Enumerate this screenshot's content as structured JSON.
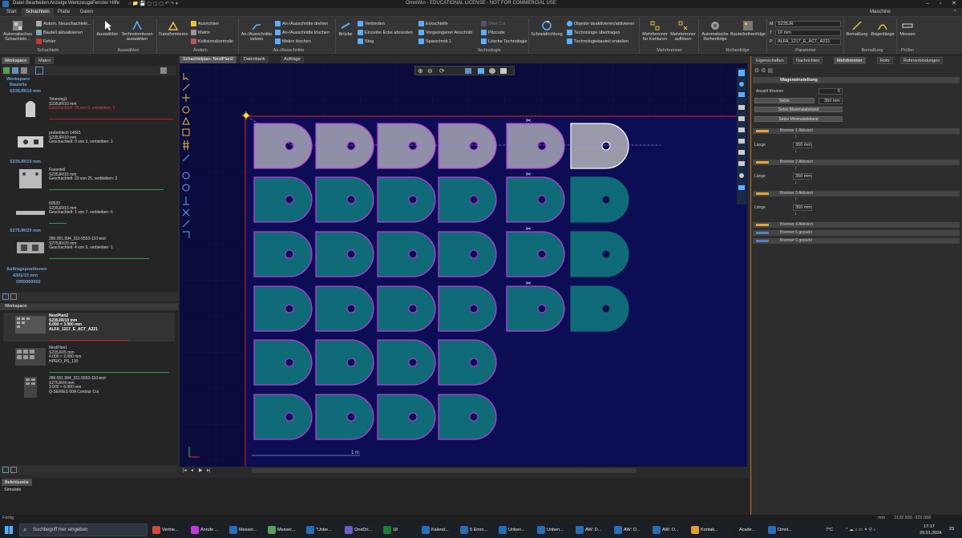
{
  "window": {
    "title": "OmniWin - EDUCATIONAL LICENSE - NOT FOR COMMERCIAL USE"
  },
  "menu": [
    "Datei",
    "Bearbeiten",
    "Anzeige",
    "Werkzeuge",
    "Fenster",
    "Hilfe"
  ],
  "tabs": [
    "Start",
    "Schachteln",
    "Platte",
    "Daten"
  ],
  "active_tab": "Schachteln",
  "machine_label": "Maschine",
  "ribbon": {
    "auto_schachteln": "Automatisches Schachteln...",
    "autom_neuschachteln": "Autom. Neuschachteln...",
    "bauteil_aktualisieren": "Bauteil aktualisieren",
    "fehler": "Fehler",
    "group_schachteln": "Schachteln",
    "auswaehlen": "Auswählen",
    "technokonturen": "Technokonturen auswählen",
    "group_auswaehlen": "Auswählen",
    "transformieren": "Transformieren",
    "ausrichten": "Ausrichten",
    "matrix": "Matrix",
    "kollisionskontrolle": "Kollisionskontrolle",
    "group_aendern": "Ändern",
    "an_ausschnitte_setzen": "An-/Ausschnitte setzen",
    "an_ausschnitte_drehen": "An-/Ausschnitte drehen",
    "an_ausschnitte_loeschen": "An-/Ausschnitte löschen",
    "makro_loeschen": "Makro löschen",
    "group_anausschnitte": "An-/Ausschnitte",
    "bruecke": "Brücke",
    "verbinden": "Verbinden",
    "einzelne_ecke": "Einzelne Ecke abrunden",
    "steg": "Steg",
    "eckschleife": "Eckschleife",
    "vorgezogener_anschnitt": "Vorgezogener Anschnitt",
    "sparschnitt": "Sparschnitt 1",
    "start_cut": "Start Cut",
    "pilzcode": "Pilzcode",
    "loesche_technologie": "Lösche Technologie",
    "group_technologie": "Technologie",
    "schneidrichtung": "Schneidrichtung",
    "objekte_deaktivieren": "Objekte deaktivieren/aktivieren",
    "technologie_uebertragen": "Technologie übertragen",
    "technologiebauteil": "Technologiebauteil erstellen",
    "mehrbrenner_konturen": "Mehrbrenner für Konturen",
    "mehrbrenner_aufloesen": "Mehrbrenner auflösen",
    "group_mehrbrenner": "Mehrbrenner",
    "auto_reihenfolge": "Automatische Reihenfolge",
    "bauteilreihenfolge": "Bauteilreihenfolge",
    "group_reihenfolge": "Reihenfolge",
    "param_m": "S235JR",
    "param_t": "10 mm",
    "param_p": "ALFA_1217_E_ACT_A221",
    "group_parameter": "Parameter",
    "bemassung": "Bemaßung",
    "bogenlaenge": "Bogenlänge",
    "group_bemassung": "Bemaßung",
    "messen": "Messen",
    "group_pruefen": "Prüfen"
  },
  "left_panel": {
    "tabs": [
      "Workspace",
      "Makro"
    ],
    "workspace_label": "Workspace",
    "bauteile_label": "Bauteile",
    "groups": [
      {
        "label": "S235JR/10 mm",
        "items": [
          {
            "name": "Tekening1",
            "mat": "S235JR/10 mm",
            "info": "Geschachtelt: 36 von 0, verbleiben: 0",
            "alert": true
          },
          {
            "name": "probeblech 14501",
            "mat": "S235JR/10 mm",
            "info": "Geschachtelt: 0 von 1, verbleiben: 1",
            "alert": false
          }
        ]
      },
      {
        "label": "S235JR/15 mm",
        "items": [
          {
            "name": "Fasenteil",
            "mat": "S235JR/15 mm",
            "info": "Geschachtelt: 23 von 25, verbleiben: 2",
            "alert": false
          },
          {
            "name": "60520",
            "mat": "S235JR/15 mm",
            "info": "Geschachtelt: 1 von 7, verbleiben: 6",
            "alert": false
          }
        ]
      },
      {
        "label": "S275JR/20 mm",
        "items": [
          {
            "name": "286.001.994_311-5553-110-test",
            "mat": "S275JR/20 mm",
            "info": "Geschachtelt: 4 von 5, verbleiben: 1",
            "alert": false
          }
        ]
      }
    ],
    "auftragspositionen": "Auftragspositionen",
    "auftrag_sub": "4301/10 mm",
    "auftrag_order": "ORD000002",
    "workspace2_label": "Workspace",
    "plans": [
      {
        "name": "NestPlan2",
        "mat": "S235JR/10 mm",
        "size": "6.000 × 3.000 mm",
        "param": "ALFA_1217_E_ACT_A221"
      },
      {
        "name": "NestPlan1",
        "mat": "S235JR/5 mm",
        "size": "4.000 × 2.000 mm",
        "param": "HPR/O_PS_130"
      },
      {
        "name": "286.001.994_311-5553-110-test",
        "mat": "S275JR/4 mm",
        "size": "3.000 × 6.000 mm",
        "param": "Q-SERIES 60A Contour Cut"
      }
    ]
  },
  "doc_tabs": [
    "Schachtelplan: NestPlan2",
    "Datenbank",
    "Aufträge"
  ],
  "canvas": {
    "scale_label": "1 m"
  },
  "right_panel": {
    "tabs": [
      "Eigenschaften",
      "Nachrichten",
      "Mehrbrenner",
      "Rohr",
      "Rohrverbindungen"
    ],
    "active_tab": "Mehrbrenner",
    "section_title": "Wageneinstellung",
    "anzahl_brenner_label": "Anzahl Brenner",
    "anzahl_brenner_value": "6",
    "setze_label": "Setze",
    "setze_value": "350 mm",
    "setze_max": "Setze Maximalabstand",
    "setze_min": "Setze Minimalabstand",
    "burners": [
      {
        "label": "Brenner 1 Aktiviert",
        "length": "350 mm"
      },
      {
        "label": "Brenner 2 Aktiviert",
        "length": "350 mm"
      },
      {
        "label": "Brenner 3 Aktiviert",
        "length": "350 mm"
      },
      {
        "label": "Brenner 4 Aktiviert",
        "length": ""
      },
      {
        "label": "Brenner 5 geparkt",
        "length": ""
      },
      {
        "label": "Brenner 6 geparkt",
        "length": ""
      }
    ],
    "laenge_label": "Länge"
  },
  "cmd": {
    "label": "Befehlszeile",
    "line": "Simulate"
  },
  "status": {
    "left": "Fertig",
    "unit": "mm",
    "coords": "3132.830  -325.068"
  },
  "taskbar": {
    "search": "Suchbegriff hier eingeben",
    "apps": [
      "Vertrie...",
      "Anrufe ...",
      "Messer...",
      "Messer...",
      "\"Unbe...",
      "OneDri...",
      "18",
      "Kalend...",
      "5 Erinn...",
      "Unben...",
      "Unben...",
      "AW: D...",
      "AW: O...",
      "AW: O...",
      "Kontak...",
      "Acade...",
      "Omni..."
    ],
    "weather": "7°C",
    "time": "17:17",
    "date": "29.01.2024",
    "notif": "23"
  }
}
